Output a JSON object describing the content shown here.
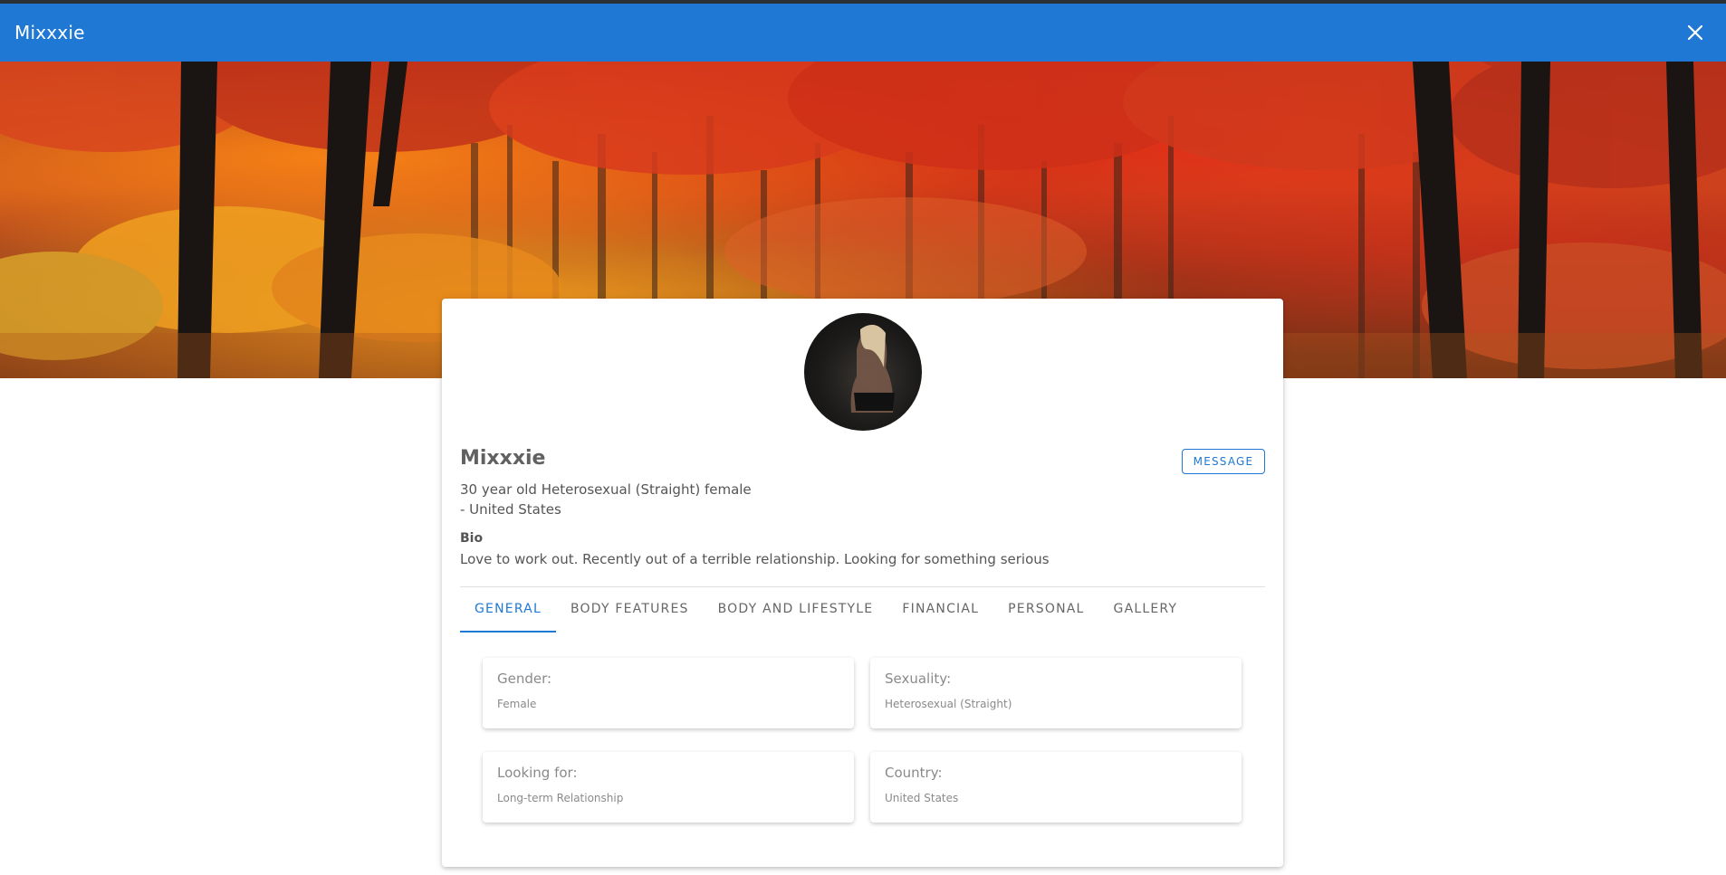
{
  "app_bar": {
    "title": "Mixxxie",
    "close_icon": "close-icon"
  },
  "banner": {
    "description_icon": "autumn-forest-image"
  },
  "profile": {
    "avatar_icon": "avatar-image",
    "name": "Mixxxie",
    "summary_line1": "30 year old Heterosexual (Straight) female",
    "summary_line2": "- United States",
    "bio_label": "Bio",
    "bio_text": "Love to work out. Recently out of a terrible relationship. Looking for something serious",
    "message_label": "MESSAGE"
  },
  "tabs": [
    {
      "label": "GENERAL",
      "active": true
    },
    {
      "label": "BODY FEATURES",
      "active": false
    },
    {
      "label": "BODY AND LIFESTYLE",
      "active": false
    },
    {
      "label": "FINANCIAL",
      "active": false
    },
    {
      "label": "PERSONAL",
      "active": false
    },
    {
      "label": "GALLERY",
      "active": false
    }
  ],
  "general": [
    {
      "label": "Gender:",
      "value": "Female"
    },
    {
      "label": "Sexuality:",
      "value": "Heterosexual (Straight)"
    },
    {
      "label": "Looking for:",
      "value": "Long-term Relationship"
    },
    {
      "label": "Country:",
      "value": "United States"
    }
  ],
  "colors": {
    "accent": "#1e78d4",
    "text": "#616161",
    "muted": "#8a8a8a"
  }
}
